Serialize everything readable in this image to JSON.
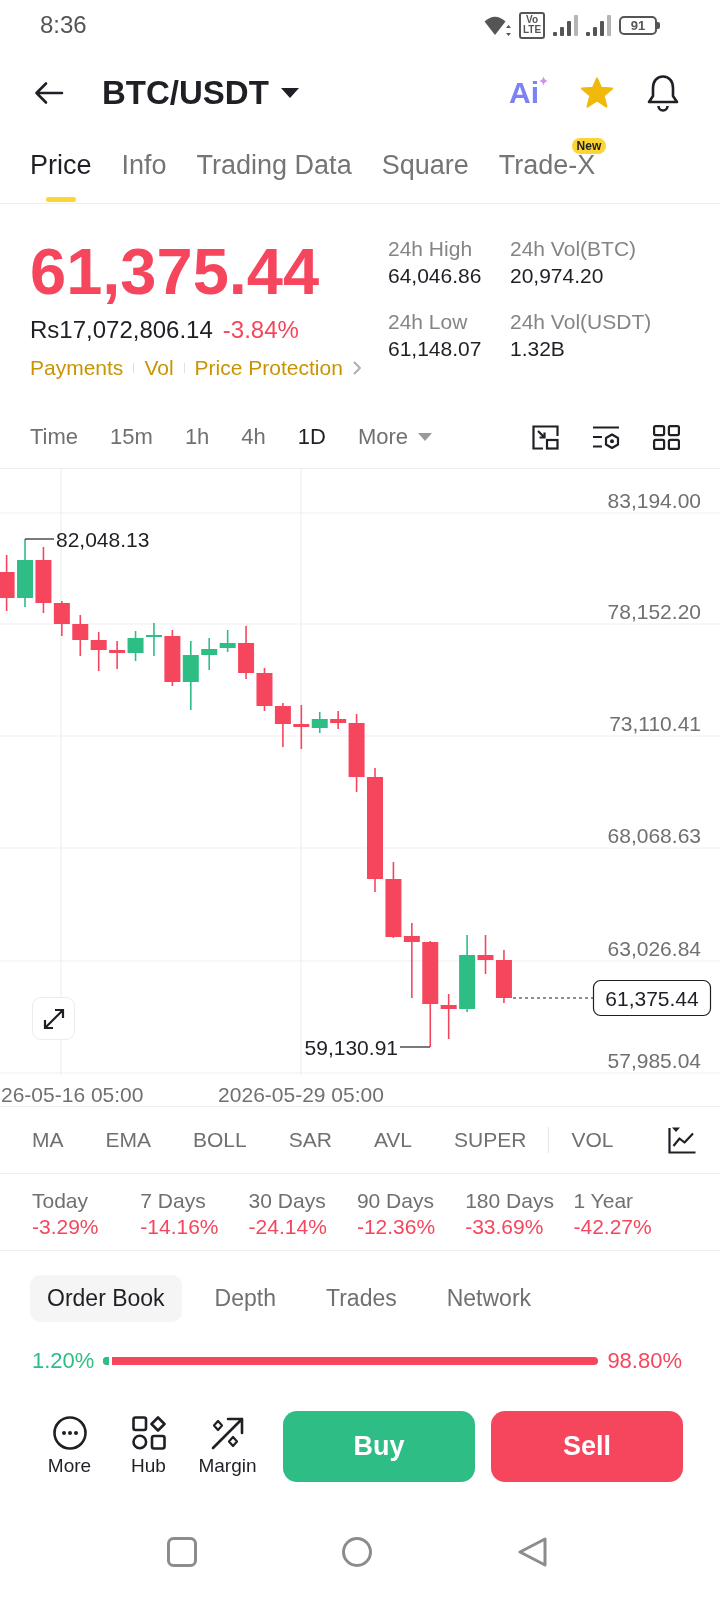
{
  "status_bar": {
    "time": "8:36",
    "network_badge": [
      "Vo",
      "LTE"
    ],
    "battery": "91"
  },
  "header": {
    "title": "BTC/USDT",
    "ai_label": "Ai",
    "favorited": true
  },
  "tabs": [
    {
      "label": "Price",
      "selected": true
    },
    {
      "label": "Info",
      "selected": false
    },
    {
      "label": "Trading Data",
      "selected": false
    },
    {
      "label": "Square",
      "selected": false
    },
    {
      "label": "Trade-X",
      "selected": false,
      "badge": "New"
    }
  ],
  "price": {
    "last": "61,375.44",
    "local_price": "Rs17,072,806.14",
    "change": "-3.84%",
    "falling": true,
    "links": [
      "Payments",
      "Vol",
      "Price Protection"
    ]
  },
  "stats_24h": [
    {
      "label": "24h High",
      "value": "64,046.86"
    },
    {
      "label": "24h Vol(BTC)",
      "value": "20,974.20"
    },
    {
      "label": "24h Low",
      "value": "61,148.07"
    },
    {
      "label": "24h Vol(USDT)",
      "value": "1.32B"
    }
  ],
  "intervals": [
    {
      "label": "Time",
      "selected": false
    },
    {
      "label": "15m",
      "selected": false
    },
    {
      "label": "1h",
      "selected": false
    },
    {
      "label": "4h",
      "selected": false
    },
    {
      "label": "1D",
      "selected": true
    }
  ],
  "more_intervals": "More",
  "chart": {
    "y_labels": [
      "83,194.00",
      "78,152.20",
      "73,110.41",
      "68,068.63",
      "63,026.84",
      "57,985.04"
    ],
    "x_labels": [
      "26-05-16 05:00",
      "2026-05-29 05:00"
    ],
    "high_label": "82,048.13",
    "low_label": "59,130.91",
    "last_price": "61,375.44"
  },
  "indicators": {
    "main": [
      {
        "label": "MA",
        "selected": false
      },
      {
        "label": "EMA",
        "selected": false
      },
      {
        "label": "BOLL",
        "selected": false
      },
      {
        "label": "SAR",
        "selected": false
      },
      {
        "label": "AVL",
        "selected": false
      },
      {
        "label": "SUPER",
        "selected": false
      }
    ],
    "sub": [
      {
        "label": "VOL",
        "selected": false
      }
    ]
  },
  "performance": [
    {
      "period": "Today",
      "change": "-3.29%",
      "falling": true
    },
    {
      "period": "7 Days",
      "change": "-14.16%",
      "falling": true
    },
    {
      "period": "30 Days",
      "change": "-24.14%",
      "falling": true
    },
    {
      "period": "90 Days",
      "change": "-12.36%",
      "falling": true
    },
    {
      "period": "180 Days",
      "change": "-33.69%",
      "falling": true
    },
    {
      "period": "1 Year",
      "change": "-42.27%",
      "falling": true
    }
  ],
  "book_tabs": [
    {
      "label": "Order Book",
      "selected": true
    },
    {
      "label": "Depth",
      "selected": false
    },
    {
      "label": "Trades",
      "selected": false
    },
    {
      "label": "Network",
      "selected": false
    }
  ],
  "order_ratio": {
    "buy": "1.20%",
    "sell": "98.80%",
    "level": 0.012
  },
  "actions": [
    {
      "label": "More"
    },
    {
      "label": "Hub"
    },
    {
      "label": "Margin"
    }
  ],
  "trade_buttons": {
    "buy": "Buy",
    "sell": "Sell"
  }
}
